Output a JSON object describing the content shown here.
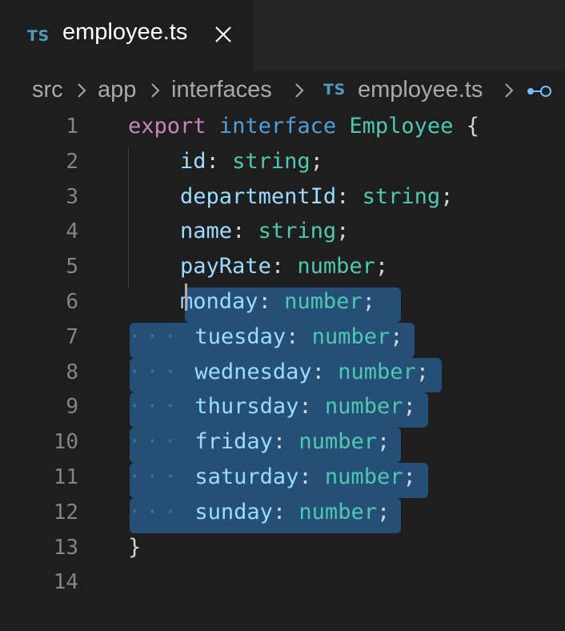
{
  "tab": {
    "language_badge": "TS",
    "title": "employee.ts"
  },
  "breadcrumb": {
    "segments": [
      "src",
      "app",
      "interfaces"
    ],
    "file_badge": "TS",
    "file": "employee.ts"
  },
  "code": {
    "line_numbers": [
      "1",
      "2",
      "3",
      "4",
      "5",
      "6",
      "7",
      "8",
      "9",
      "10",
      "11",
      "12",
      "13",
      "14"
    ],
    "keyword_export": "export",
    "keyword_interface": "interface",
    "interface_name": "Employee",
    "open_brace": "{",
    "close_brace": "}",
    "colon": ":",
    "semicolon": ";",
    "whitespace_marker": "···",
    "properties": [
      {
        "name": "id",
        "type": "string"
      },
      {
        "name": "departmentId",
        "type": "string"
      },
      {
        "name": "name",
        "type": "string"
      },
      {
        "name": "payRate",
        "type": "number"
      },
      {
        "name": "monday",
        "type": "number"
      },
      {
        "name": "tuesday",
        "type": "number"
      },
      {
        "name": "wednesday",
        "type": "number"
      },
      {
        "name": "thursday",
        "type": "number"
      },
      {
        "name": "friday",
        "type": "number"
      },
      {
        "name": "saturday",
        "type": "number"
      },
      {
        "name": "sunday",
        "type": "number"
      }
    ]
  },
  "colors": {
    "keyword": "#c586c0",
    "keyword_interface": "#569cd6",
    "type": "#4ec9b0",
    "property": "#9cdcfe",
    "selection": "#264f78",
    "ts_badge": "#519aba"
  },
  "icons": {
    "tab_close": "close-icon",
    "breadcrumb_separator": "chevron-right-icon",
    "symbol": "symbol-field-icon"
  }
}
